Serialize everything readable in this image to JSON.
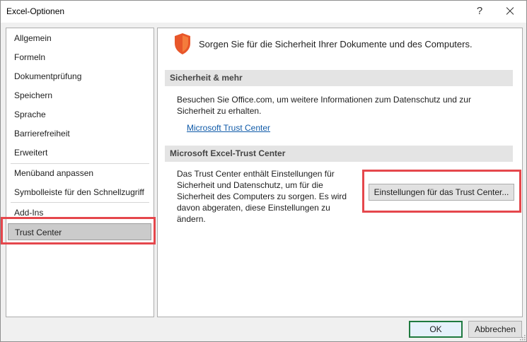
{
  "window": {
    "title": "Excel-Optionen",
    "help_label": "?"
  },
  "nav": {
    "items": [
      {
        "label": "Allgemein"
      },
      {
        "label": "Formeln"
      },
      {
        "label": "Dokumentprüfung"
      },
      {
        "label": "Speichern"
      },
      {
        "label": "Sprache"
      },
      {
        "label": "Barrierefreiheit"
      },
      {
        "label": "Erweitert"
      },
      {
        "label": "Menüband anpassen"
      },
      {
        "label": "Symbolleiste für den Schnellzugriff"
      },
      {
        "label": "Add-Ins"
      },
      {
        "label": "Trust Center"
      }
    ],
    "selected": "Trust Center"
  },
  "main": {
    "icon": "shield-icon",
    "title": "Sorgen Sie für die Sicherheit Ihrer Dokumente und des Computers.",
    "section1": {
      "heading": "Sicherheit & mehr",
      "text": "Besuchen Sie Office.com, um weitere Informationen zum Datenschutz und zur Sicherheit zu erhalten.",
      "link": "Microsoft Trust Center"
    },
    "section2": {
      "heading": "Microsoft Excel-Trust Center",
      "text": "Das Trust Center enthält Einstellungen für Sicherheit und Datenschutz, um für die Sicherheit des Computers zu sorgen. Es wird davon abgeraten, diese Einstellungen zu ändern.",
      "button": "Einstellungen für das Trust Center..."
    }
  },
  "footer": {
    "ok": "OK",
    "cancel": "Abbrechen"
  },
  "colors": {
    "highlight": "#e5474c",
    "shield": "#e8562a",
    "link": "#0f5aa8",
    "ok_border": "#1f7a3f"
  }
}
